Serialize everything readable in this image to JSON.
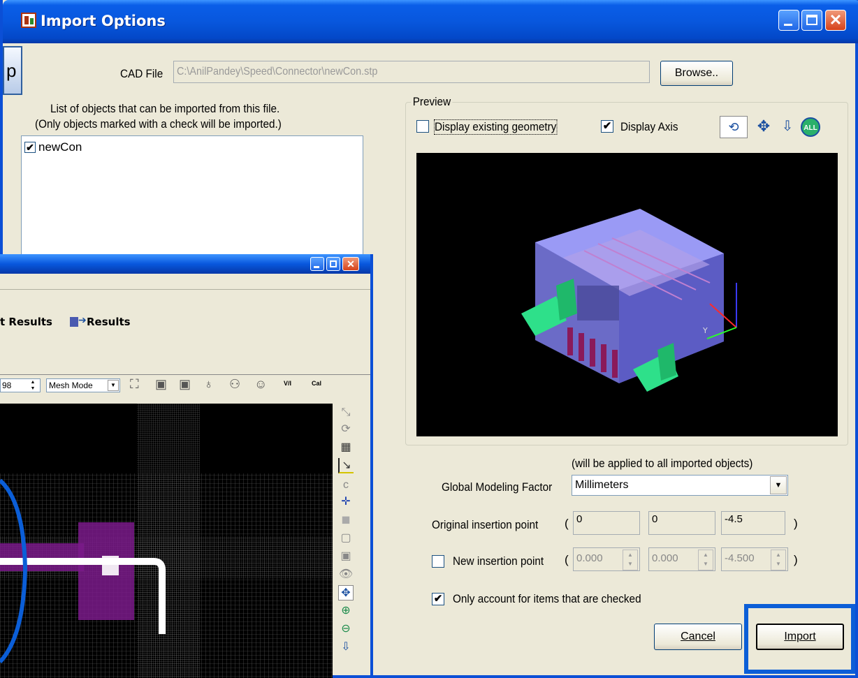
{
  "window": {
    "title": "Import Options"
  },
  "callout_fragment": "p",
  "cad_file": {
    "label": "CAD File",
    "path": "C:\\AnilPandey\\Speed\\Connector\\newCon.stp",
    "browse_label": "Browse.."
  },
  "objects": {
    "header_line1": "List of objects that can be imported from this file.",
    "header_line2": "(Only objects marked with a check will be imported.)",
    "items": [
      {
        "label": "newCon",
        "checked": true
      }
    ]
  },
  "preview": {
    "group_label": "Preview",
    "display_existing_label": "Display existing geometry",
    "display_existing_checked": false,
    "display_axis_label": "Display Axis",
    "display_axis_checked": true,
    "icons": [
      "rotate-icon",
      "pan-icon",
      "zoom-icon",
      "zoom-all-icon"
    ]
  },
  "modeling": {
    "note": "(will be applied to all imported objects)",
    "label": "Global Modeling Factor",
    "selected": "Millimeters"
  },
  "original_point": {
    "label": "Original insertion point",
    "x": "0",
    "y": "0",
    "z": "-4.5",
    "open": "(",
    "close": ")"
  },
  "new_point": {
    "label": "New insertion point",
    "checked": false,
    "x": "0.000",
    "y": "0.000",
    "z": "-4.500",
    "open": "(",
    "close": ")"
  },
  "only_checked": {
    "label": "Only account for items that are checked",
    "checked": true
  },
  "buttons": {
    "cancel": "Cancel",
    "import": "Import"
  },
  "sub_window": {
    "tabs_text": "t Results",
    "results_label": "Results",
    "spin_value": "98",
    "mode_selected": "Mesh Mode",
    "toolbar_labels": [
      "V/I",
      "Cal"
    ]
  },
  "colors": {
    "titlebar": "#0857dd",
    "window_bg": "#ece9d8",
    "highlight": "#0b5ed7",
    "model": "#8c8cf0",
    "pins": "#2ee08a",
    "mesh_magenta": "#7a1a8a"
  }
}
